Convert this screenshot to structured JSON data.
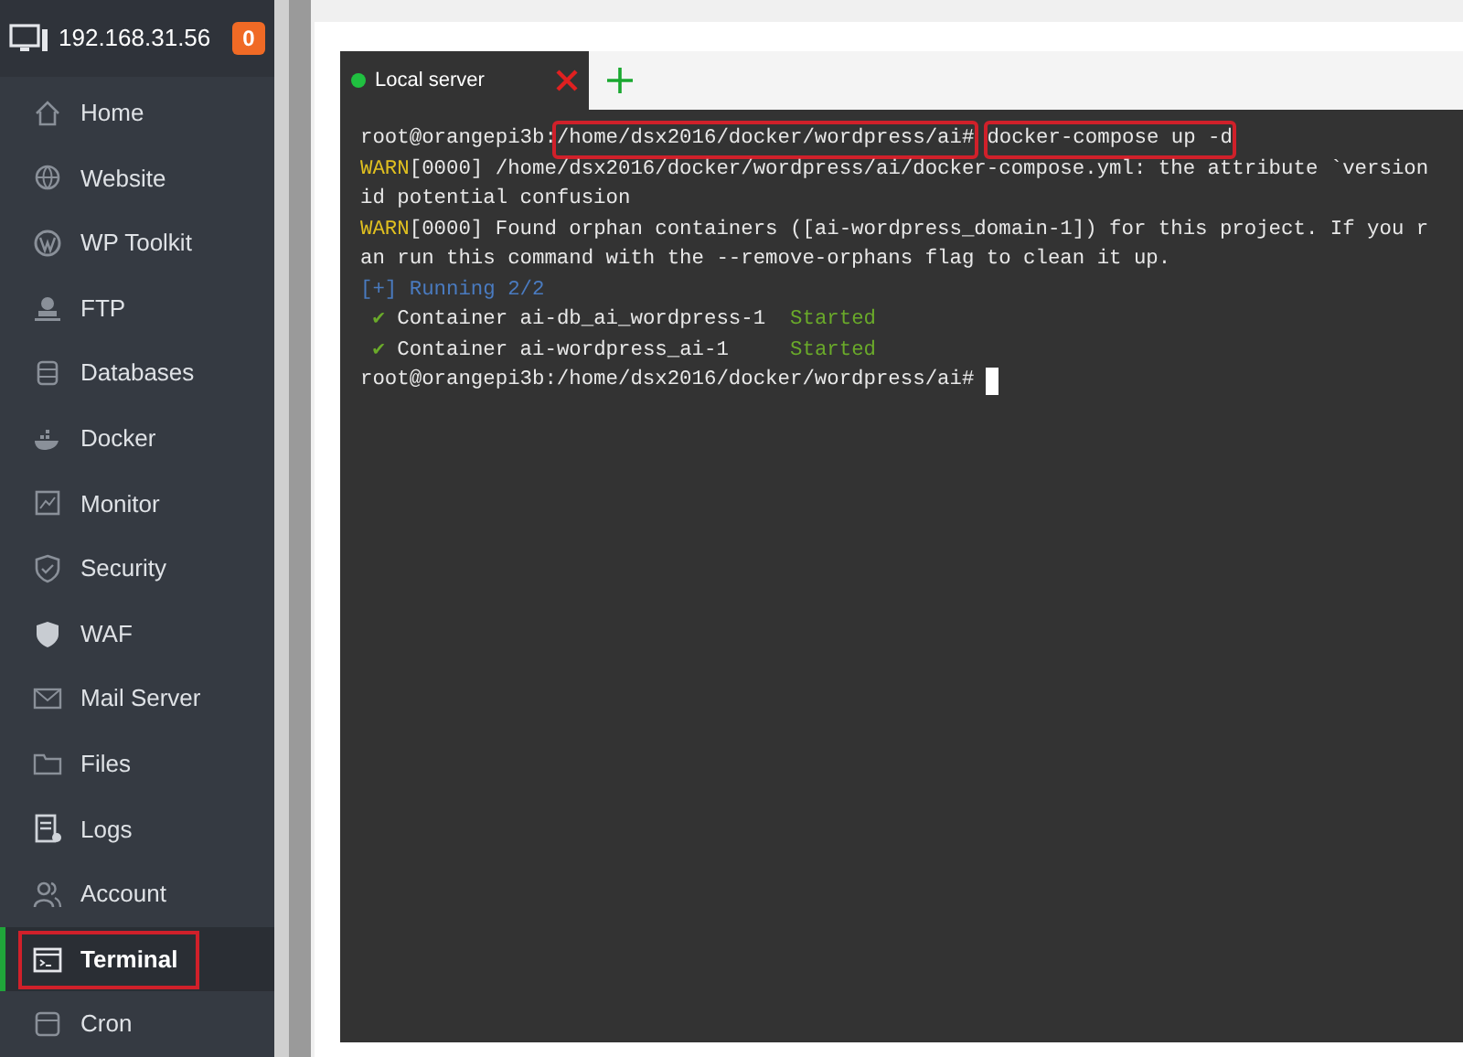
{
  "sidebar": {
    "server": "192.168.31.56",
    "badge": "0",
    "items": [
      {
        "label": "Home",
        "selected": false,
        "highlighted": false
      },
      {
        "label": "Website",
        "selected": false,
        "highlighted": false
      },
      {
        "label": "WP Toolkit",
        "selected": false,
        "highlighted": false
      },
      {
        "label": "FTP",
        "selected": false,
        "highlighted": false
      },
      {
        "label": "Databases",
        "selected": false,
        "highlighted": false
      },
      {
        "label": "Docker",
        "selected": false,
        "highlighted": false
      },
      {
        "label": "Monitor",
        "selected": false,
        "highlighted": false
      },
      {
        "label": "Security",
        "selected": false,
        "highlighted": false
      },
      {
        "label": "WAF",
        "selected": false,
        "highlighted": false
      },
      {
        "label": "Mail Server",
        "selected": false,
        "highlighted": false
      },
      {
        "label": "Files",
        "selected": false,
        "highlighted": false
      },
      {
        "label": "Logs",
        "selected": false,
        "highlighted": false
      },
      {
        "label": "Account",
        "selected": false,
        "highlighted": false
      },
      {
        "label": "Terminal",
        "selected": true,
        "highlighted": true
      },
      {
        "label": "Cron",
        "selected": false,
        "highlighted": false
      }
    ]
  },
  "terminal": {
    "tabs": [
      {
        "label": "Local server",
        "selected": true,
        "connected": true
      }
    ],
    "lines": [
      [
        {
          "kind": "plain",
          "text": "root@orangepi3b:",
          "highlighted": false
        },
        {
          "kind": "plain",
          "text": "/home/dsx2016/docker/wordpress/ai#",
          "highlighted": true
        },
        {
          "kind": "plain",
          "text": "docker-compose up -d",
          "highlighted": true
        }
      ],
      [
        {
          "kind": "warn",
          "text": "WARN",
          "highlighted": false
        },
        {
          "kind": "plain",
          "text": "[0000] /home/dsx2016/docker/wordpress/ai/docker-compose.yml: the attribute `version",
          "highlighted": false
        }
      ],
      [
        {
          "kind": "plain",
          "text": "id potential confusion",
          "highlighted": false
        }
      ],
      [
        {
          "kind": "warn",
          "text": "WARN",
          "highlighted": false
        },
        {
          "kind": "plain",
          "text": "[0000] Found orphan containers ([ai-wordpress_domain-1]) for this project. If you r",
          "highlighted": false
        }
      ],
      [
        {
          "kind": "plain",
          "text": "an run this command with the --remove-orphans flag to clean it up.",
          "highlighted": false
        }
      ],
      [
        {
          "kind": "info",
          "text": "[+] Running 2/2",
          "highlighted": false
        }
      ],
      [
        {
          "kind": "success",
          "text": " ✔",
          "highlighted": false
        },
        {
          "kind": "plain",
          "text": " Container ai-db_ai_wordpress-1  ",
          "highlighted": false
        },
        {
          "kind": "success",
          "text": "Started",
          "highlighted": false
        }
      ],
      [
        {
          "kind": "success",
          "text": " ✔",
          "highlighted": false
        },
        {
          "kind": "plain",
          "text": " Container ai-wordpress_ai-1     ",
          "highlighted": false
        },
        {
          "kind": "success",
          "text": "Started",
          "highlighted": false
        }
      ],
      [
        {
          "kind": "plain",
          "text": "root@orangepi3b:/home/dsx2016/docker/wordpress/ai# ",
          "highlighted": false
        }
      ]
    ],
    "cursor": true
  }
}
